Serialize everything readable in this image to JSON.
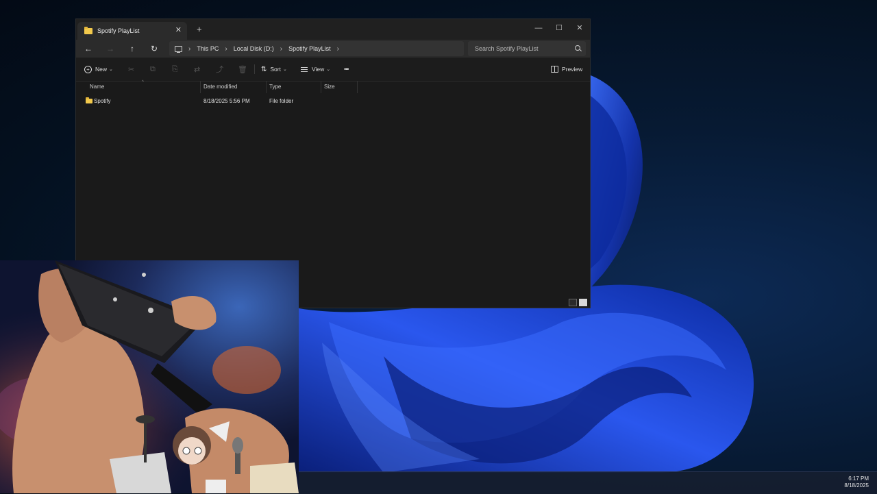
{
  "window": {
    "tab_title": "Spotify PlayList",
    "tab_close": "✕",
    "new_tab": "+",
    "controls": {
      "minimize": "—",
      "maximize": "☐",
      "close": "✕"
    }
  },
  "nav": {
    "back": "←",
    "forward": "→",
    "up": "↑",
    "refresh": "↻",
    "breadcrumbs": [
      "This PC",
      "Local Disk (D:)",
      "Spotify PlayList"
    ],
    "separator": "›",
    "search_placeholder": "Search Spotify PlayList"
  },
  "toolbar": {
    "new_label": "New",
    "new_plus": "+",
    "chevron": "⌄",
    "sort_label": "Sort",
    "sort_glyph": "⇅",
    "view_label": "View",
    "more": "•••",
    "preview_label": "Preview",
    "dim_icons": [
      "✂",
      "⧉",
      "⎘",
      "⇄",
      "⤴",
      "🗑"
    ]
  },
  "columns": [
    "Name",
    "Date modified",
    "Type",
    "Size"
  ],
  "sort_caret": "^",
  "files": [
    {
      "name": "Spotify",
      "date": "8/18/2025 5:56 PM",
      "type": "File folder",
      "size": ""
    }
  ],
  "taskbar": {
    "time": "6:17 PM",
    "date": "8/18/2025"
  },
  "colors": {
    "window_bg": "#1a1a1a",
    "titlebar": "#202020",
    "wallpaper_blue": "#1f45d6",
    "folder": "#f2c94c"
  }
}
